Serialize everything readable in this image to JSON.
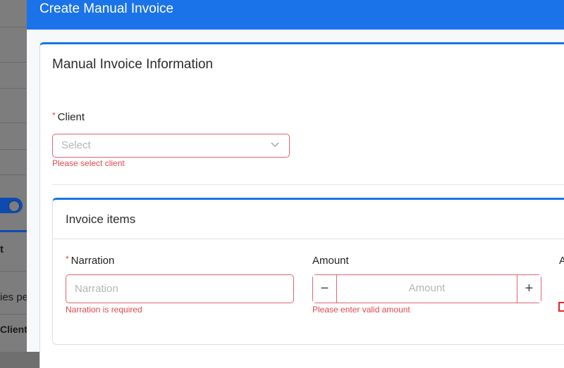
{
  "background": {
    "rows": [
      "ies pe",
      "Client",
      "t"
    ]
  },
  "drawer": {
    "title": "Create Manual Invoice"
  },
  "manual_invoice": {
    "title": "Manual Invoice Information",
    "client": {
      "required_mark": "*",
      "label": "Client",
      "placeholder": "Select",
      "error": "Please select client"
    }
  },
  "invoice_items": {
    "title": "Invoice items",
    "narration": {
      "required_mark": "*",
      "label": "Narration",
      "placeholder": "Narration",
      "error": "Narration is required"
    },
    "amount": {
      "label": "Amount",
      "placeholder": "Amount",
      "error": "Please enter valid amount",
      "minus": "−",
      "plus": "+"
    },
    "next_column_label": "A"
  },
  "colors": {
    "header": "#1a73e8",
    "error": "#e0474f",
    "error_border": "#e06470"
  }
}
